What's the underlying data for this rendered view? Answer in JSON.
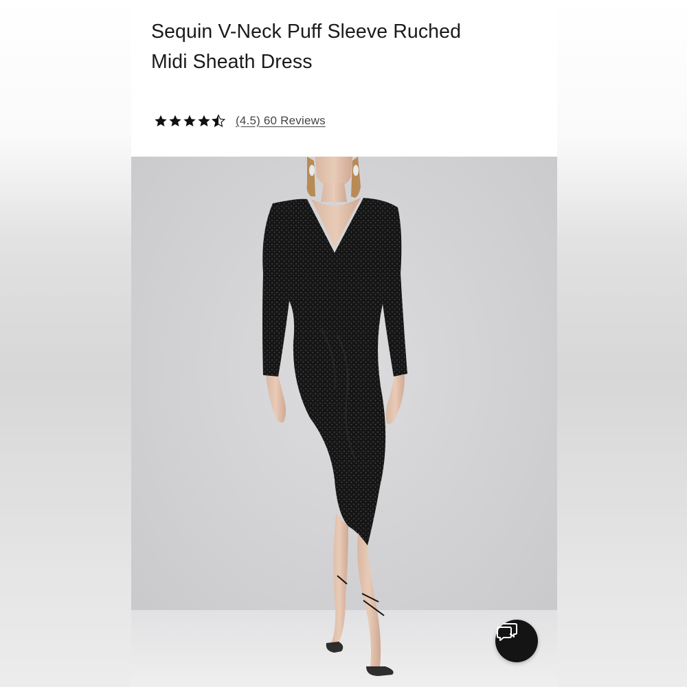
{
  "product": {
    "title_line1": "Sequin V-Neck Puff Sleeve Ruched",
    "title_line2": "Midi Sheath Dress",
    "rating_value": 4.5,
    "rating_max": 5,
    "rating_text": "(4.5)",
    "reviews_text": "60 Reviews"
  },
  "image": {
    "subject": "model wearing black sequin dress"
  },
  "chat": {
    "icon": "chat-bubbles-icon"
  },
  "colors": {
    "text": "#1a1a1a",
    "star": "#111111",
    "chat_button": "#141414"
  }
}
